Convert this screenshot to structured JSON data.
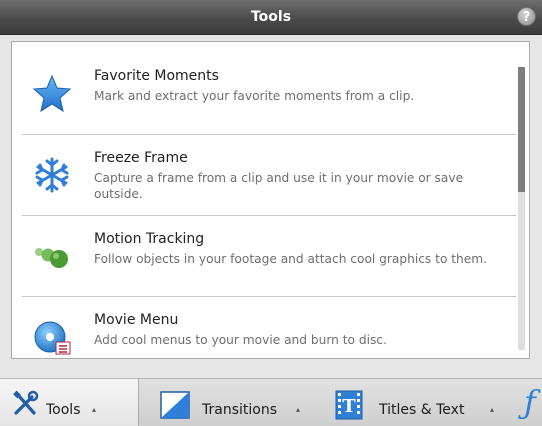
{
  "window": {
    "title": "Tools",
    "help_label": "?"
  },
  "tools": [
    {
      "name": "Favorite Moments",
      "description": "Mark and extract your favorite moments from a clip.",
      "icon": "star-icon"
    },
    {
      "name": "Freeze Frame",
      "description": "Capture a frame from a clip and use it in your movie or save outside.",
      "icon": "snowflake-icon"
    },
    {
      "name": "Motion Tracking",
      "description": "Follow objects in your footage and attach cool graphics to them.",
      "icon": "motion-tracking-icon"
    },
    {
      "name": "Movie Menu",
      "description": "Add cool menus to your movie and burn to disc.",
      "icon": "disc-menu-icon"
    }
  ],
  "tabs": [
    {
      "label": "Tools",
      "arrow": "▴",
      "icon": "wrench-screwdriver-icon",
      "active": true
    },
    {
      "label": "Transitions",
      "arrow": "▴",
      "icon": "transition-icon"
    },
    {
      "label": "Titles & Text",
      "arrow": "▴",
      "icon": "titles-text-icon"
    }
  ],
  "colors": {
    "accent_blue": "#2f7fd6",
    "green": "#5aa83c",
    "title_bar": "#4a4a4a"
  }
}
